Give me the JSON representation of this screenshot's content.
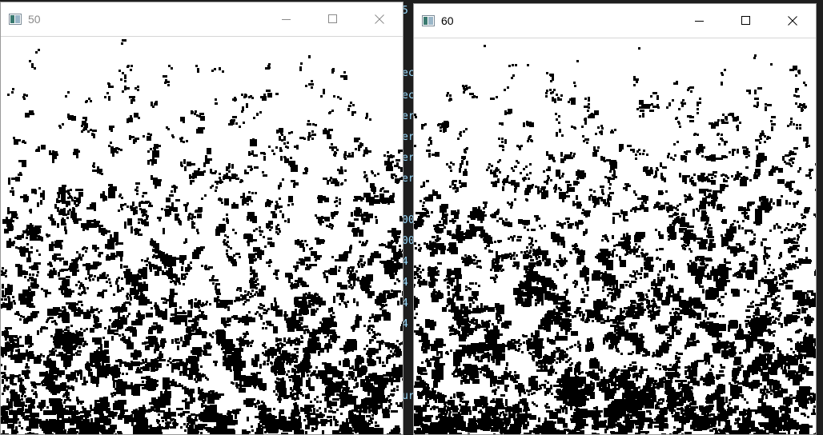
{
  "background_editor": {
    "fragments": [
      "5",
      "ec",
      "ec",
      "er",
      "er",
      "er",
      "er",
      "00",
      "00",
      "4",
      "4",
      "4",
      "4",
      "ur"
    ]
  },
  "windows": [
    {
      "title": "50",
      "state": "inactive",
      "icon": "opencv-window-icon",
      "controls": [
        "minimize-icon",
        "maximize-icon",
        "close-icon"
      ],
      "threshold_image": {
        "density": 0.13,
        "seed": 50
      }
    },
    {
      "title": "60",
      "state": "active",
      "icon": "opencv-window-icon",
      "controls": [
        "minimize-icon",
        "maximize-icon",
        "close-icon"
      ],
      "threshold_image": {
        "density": 0.16,
        "seed": 60
      }
    }
  ],
  "colors": {
    "title_inactive": "#8a8a8a",
    "title_active": "#000000",
    "ink": "#000000",
    "paper": "#ffffff",
    "editor_bg": "#1e1e1e",
    "editor_text": "#9cdcfe"
  }
}
